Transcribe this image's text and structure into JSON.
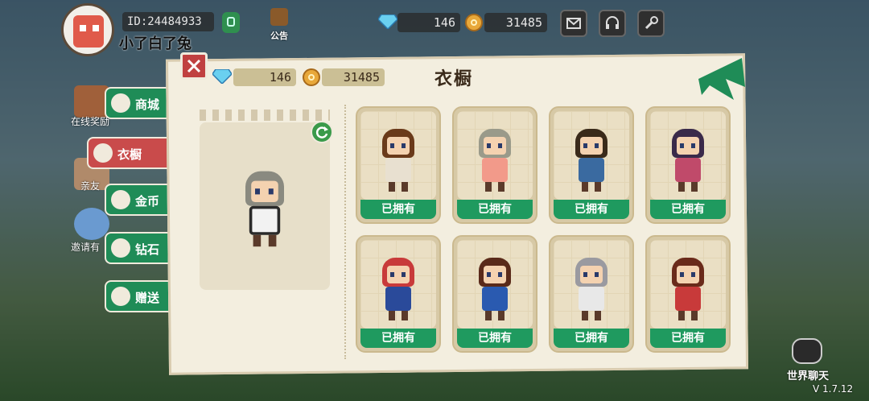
{
  "hud": {
    "player_id": "ID:24484933",
    "nickname": "小了白了兔",
    "notice_label": "公告",
    "diamonds": "146",
    "coins": "31485"
  },
  "side_menu": [
    {
      "label": "商城",
      "icon": "shirt-icon",
      "active": false
    },
    {
      "label": "衣橱",
      "icon": "wardrobe-icon",
      "active": true
    },
    {
      "label": "金币",
      "icon": "coin-icon",
      "active": false
    },
    {
      "label": "钻石",
      "icon": "diamond-icon",
      "active": false
    },
    {
      "label": "赠送",
      "icon": "gift-icon",
      "active": false
    }
  ],
  "side_bg_labels": [
    "在线奖励",
    "亲友",
    "邀请有"
  ],
  "panel": {
    "title": "衣橱",
    "diamonds": "146",
    "coins": "31485"
  },
  "outfits": [
    {
      "status": "已拥有",
      "hair": "#6a3a1a",
      "body": "#e8e0d0"
    },
    {
      "status": "已拥有",
      "hair": "#9a9a8a",
      "body": "#f29a8a"
    },
    {
      "status": "已拥有",
      "hair": "#3a2a1a",
      "body": "#3a6aa0"
    },
    {
      "status": "已拥有",
      "hair": "#3a2a4a",
      "body": "#c04a6a"
    },
    {
      "status": "已拥有",
      "hair": "#c83a3a",
      "body": "#2a4a9a"
    },
    {
      "status": "已拥有",
      "hair": "#5a2a1a",
      "body": "#2a5ab0"
    },
    {
      "status": "已拥有",
      "hair": "#9a9aa0",
      "body": "#e8e8e8"
    },
    {
      "status": "已拥有",
      "hair": "#6a2a1a",
      "body": "#c83a3a"
    }
  ],
  "chat_label": "世界聊天",
  "version": "V 1.7.12",
  "colors": {
    "accent_green": "#1f9a5f",
    "active_red": "#c94b4b",
    "panel": "#f3eedf"
  }
}
